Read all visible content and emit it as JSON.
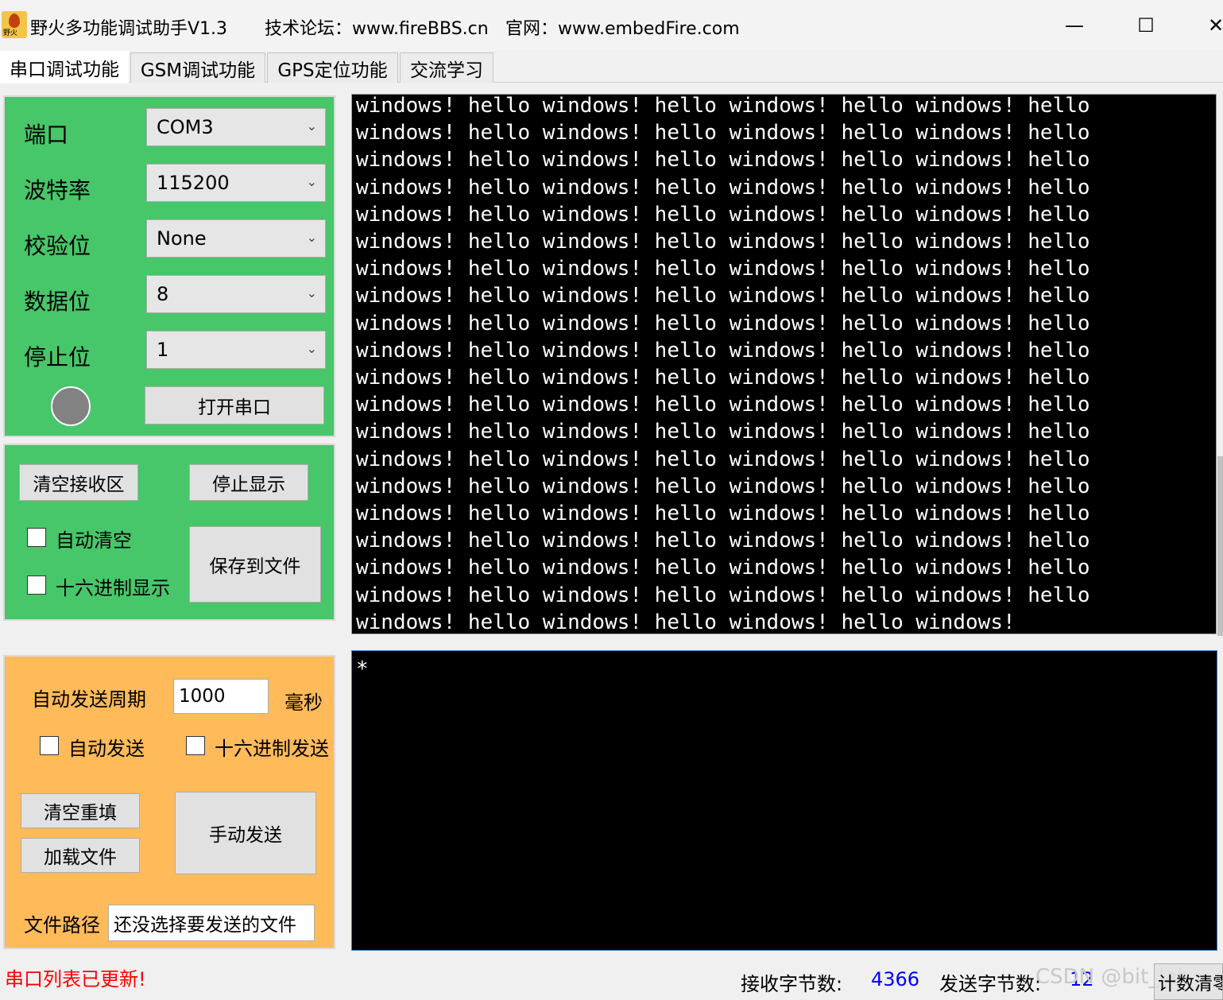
{
  "window": {
    "app_tag": "野火",
    "title": "野火多功能调试助手V1.3",
    "forum": "技术论坛：www.fireBBS.cn",
    "site": "官网：www.embedFire.com",
    "minimize": "—",
    "maximize": "☐",
    "close": "✕"
  },
  "tabs": [
    "串口调试功能",
    "GSM调试功能",
    "GPS定位功能",
    "交流学习"
  ],
  "serial": {
    "port_label": "端口",
    "port_value": "COM3",
    "baud_label": "波特率",
    "baud_value": "115200",
    "parity_label": "校验位",
    "parity_value": "None",
    "databits_label": "数据位",
    "databits_value": "8",
    "stopbits_label": "停止位",
    "stopbits_value": "1",
    "open_button": "打开串口",
    "status_led_color": "#828282"
  },
  "receive": {
    "clear_button": "清空接收区",
    "stop_button": "停止显示",
    "auto_clear": "自动清空",
    "hex_display": "十六进制显示",
    "save_button": "保存到文件",
    "lines": [
      "windows! hello windows! hello windows! hello windows! hello",
      "windows! hello windows! hello windows! hello windows! hello",
      "windows! hello windows! hello windows! hello windows! hello",
      "windows! hello windows! hello windows! hello windows! hello",
      "windows! hello windows! hello windows! hello windows! hello",
      "windows! hello windows! hello windows! hello windows! hello",
      "windows! hello windows! hello windows! hello windows! hello",
      "windows! hello windows! hello windows! hello windows! hello",
      "windows! hello windows! hello windows! hello windows! hello",
      "windows! hello windows! hello windows! hello windows! hello",
      "windows! hello windows! hello windows! hello windows! hello",
      "windows! hello windows! hello windows! hello windows! hello",
      "windows! hello windows! hello windows! hello windows! hello",
      "windows! hello windows! hello windows! hello windows! hello",
      "windows! hello windows! hello windows! hello windows! hello",
      "windows! hello windows! hello windows! hello windows! hello",
      "windows! hello windows! hello windows! hello windows! hello",
      "windows! hello windows! hello windows! hello windows! hello",
      "windows! hello windows! hello windows! hello windows! hello",
      "windows! hello windows! hello windows! hello windows!"
    ]
  },
  "send": {
    "period_label": "自动发送周期",
    "period_value": "1000",
    "period_unit": "毫秒",
    "auto_send": "自动发送",
    "hex_send": "十六进制发送",
    "clear_button": "清空重填",
    "load_button": "加载文件",
    "manual_button": "手动发送",
    "path_label": "文件路径",
    "path_value": "还没选择要发送的文件",
    "content": "*"
  },
  "status": {
    "message": "串口列表已更新!",
    "rx_label": "接收字节数:",
    "rx_count": "4366",
    "tx_label": "发送字节数:",
    "tx_count": "12",
    "reset_button": "计数清零",
    "watermark": "CSDN @bit_lab"
  },
  "colors": {
    "serial_panel": "#48c66a",
    "send_panel": "#ffba59",
    "terminal_bg": "#000000",
    "error_text": "#ff0000",
    "count_text": "#0000ff"
  }
}
